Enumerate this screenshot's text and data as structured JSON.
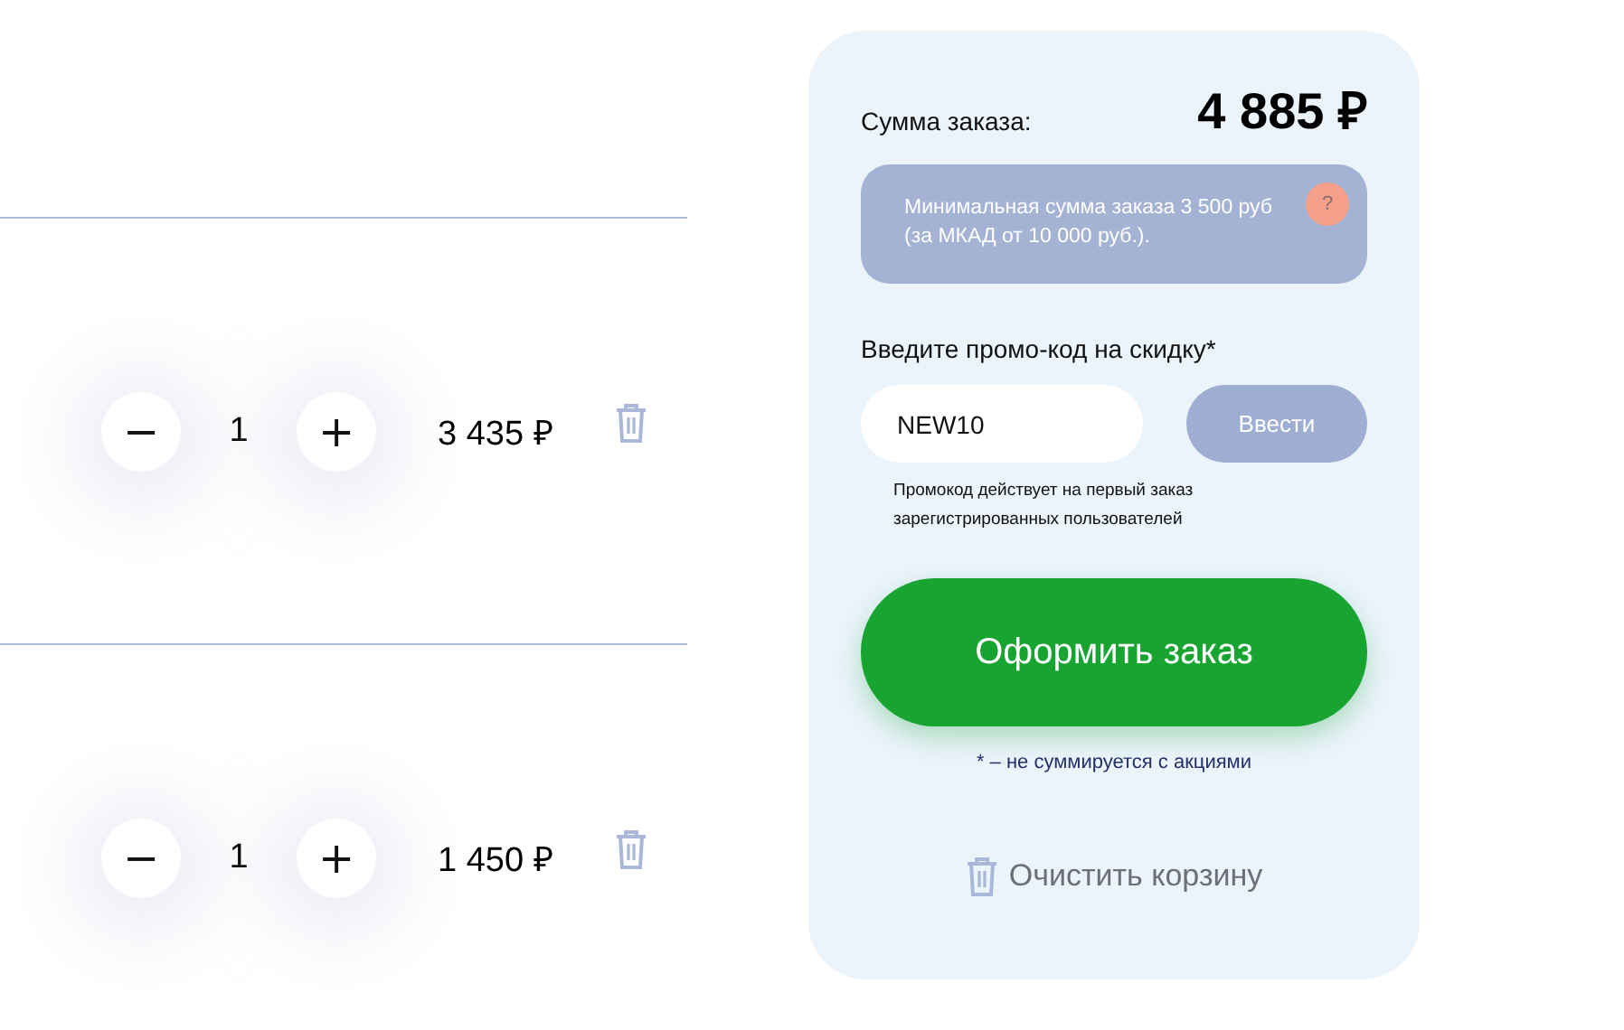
{
  "cart_items": [
    {
      "minus": "−",
      "quantity": "1",
      "plus": "+",
      "price": "3 435 ₽"
    },
    {
      "minus": "−",
      "quantity": "1",
      "plus": "+",
      "price": "1 450 ₽"
    }
  ],
  "summary": {
    "total_label": "Сумма заказа:",
    "total": "4 885 ₽",
    "notice": "Минимальная сумма заказа 3 500 руб (за МКАД от 10 000 руб.).",
    "notice_help": "?",
    "promo_label": "Введите промо-код на скидку*",
    "promo_value": "NEW10",
    "promo_button": "Ввести",
    "promo_note": "Промокод действует на первый заказ зарегистрированных пользователей",
    "checkout_button": "Оформить заказ",
    "footnote": "* – не суммируется с акциями",
    "clear_button": "Очистить корзину"
  }
}
